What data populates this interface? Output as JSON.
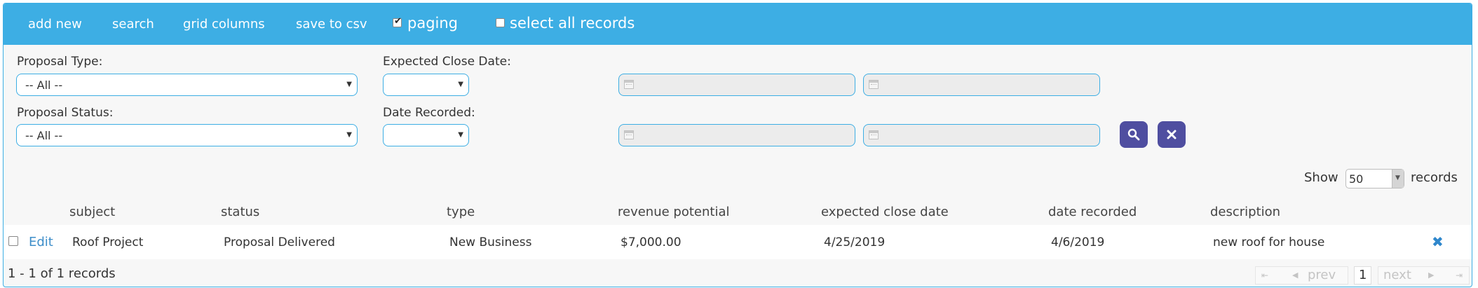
{
  "toolbar": {
    "add_new": "add new",
    "search": "search",
    "grid_columns": "grid columns",
    "save_to_csv": "save to csv",
    "paging_label": "paging",
    "paging_checked": true,
    "select_all_label": "select all records",
    "select_all_checked": false
  },
  "filters": {
    "proposal_type_label": "Proposal Type:",
    "proposal_type_value": "-- All --",
    "proposal_status_label": "Proposal Status:",
    "proposal_status_value": "-- All --",
    "expected_close_label": "Expected Close Date:",
    "expected_close_value": "",
    "date_recorded_label": "Date Recorded:",
    "date_recorded_value": "",
    "expected_close_from": "",
    "expected_close_to": "",
    "date_recorded_from": "",
    "date_recorded_to": ""
  },
  "paging": {
    "show_label": "Show",
    "page_size": "50",
    "records_label": "records",
    "summary": "1 - 1 of 1 records",
    "prev": "prev",
    "next": "next",
    "current_page": "1"
  },
  "table": {
    "columns": [
      "subject",
      "status",
      "type",
      "revenue potential",
      "expected close date",
      "date recorded",
      "description"
    ],
    "rows": [
      {
        "edit": "Edit",
        "subject": "Roof Project",
        "status": "Proposal Delivered",
        "type": "New Business",
        "revenue_potential": "$7,000.00",
        "expected_close_date": "4/25/2019",
        "date_recorded": "4/6/2019",
        "description": "new roof for house"
      }
    ]
  },
  "icons": {
    "search": "search-icon",
    "clear": "close-icon",
    "calendar": "calendar-icon",
    "delete": "delete-icon"
  },
  "colors": {
    "toolbar": "#3daee4",
    "button": "#4f4ea0",
    "link": "#3e8ec9"
  }
}
